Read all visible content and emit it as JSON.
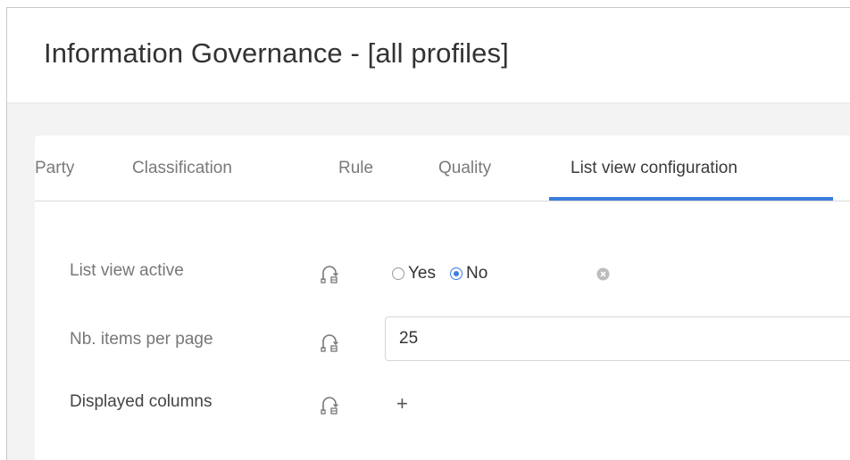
{
  "header": {
    "title": "Information Governance - [all profiles]"
  },
  "tabs": [
    {
      "label": "Party",
      "active": false
    },
    {
      "label": "Classification",
      "active": false
    },
    {
      "label": "Rule",
      "active": false
    },
    {
      "label": "Quality",
      "active": false
    },
    {
      "label": "List view configuration",
      "active": true
    }
  ],
  "form": {
    "list_view_active": {
      "label": "List view active",
      "options": [
        "Yes",
        "No"
      ],
      "selected": "No"
    },
    "items_per_page": {
      "label": "Nb. items per page",
      "value": "25"
    },
    "displayed_columns": {
      "label": "Displayed columns",
      "add_label": "+"
    }
  },
  "colors": {
    "accent": "#3b7ddd",
    "label_text": "#777777",
    "body_background": "#f3f3f3"
  },
  "icons": {
    "inherit": "inherit-icon",
    "clear": "clear-icon"
  }
}
